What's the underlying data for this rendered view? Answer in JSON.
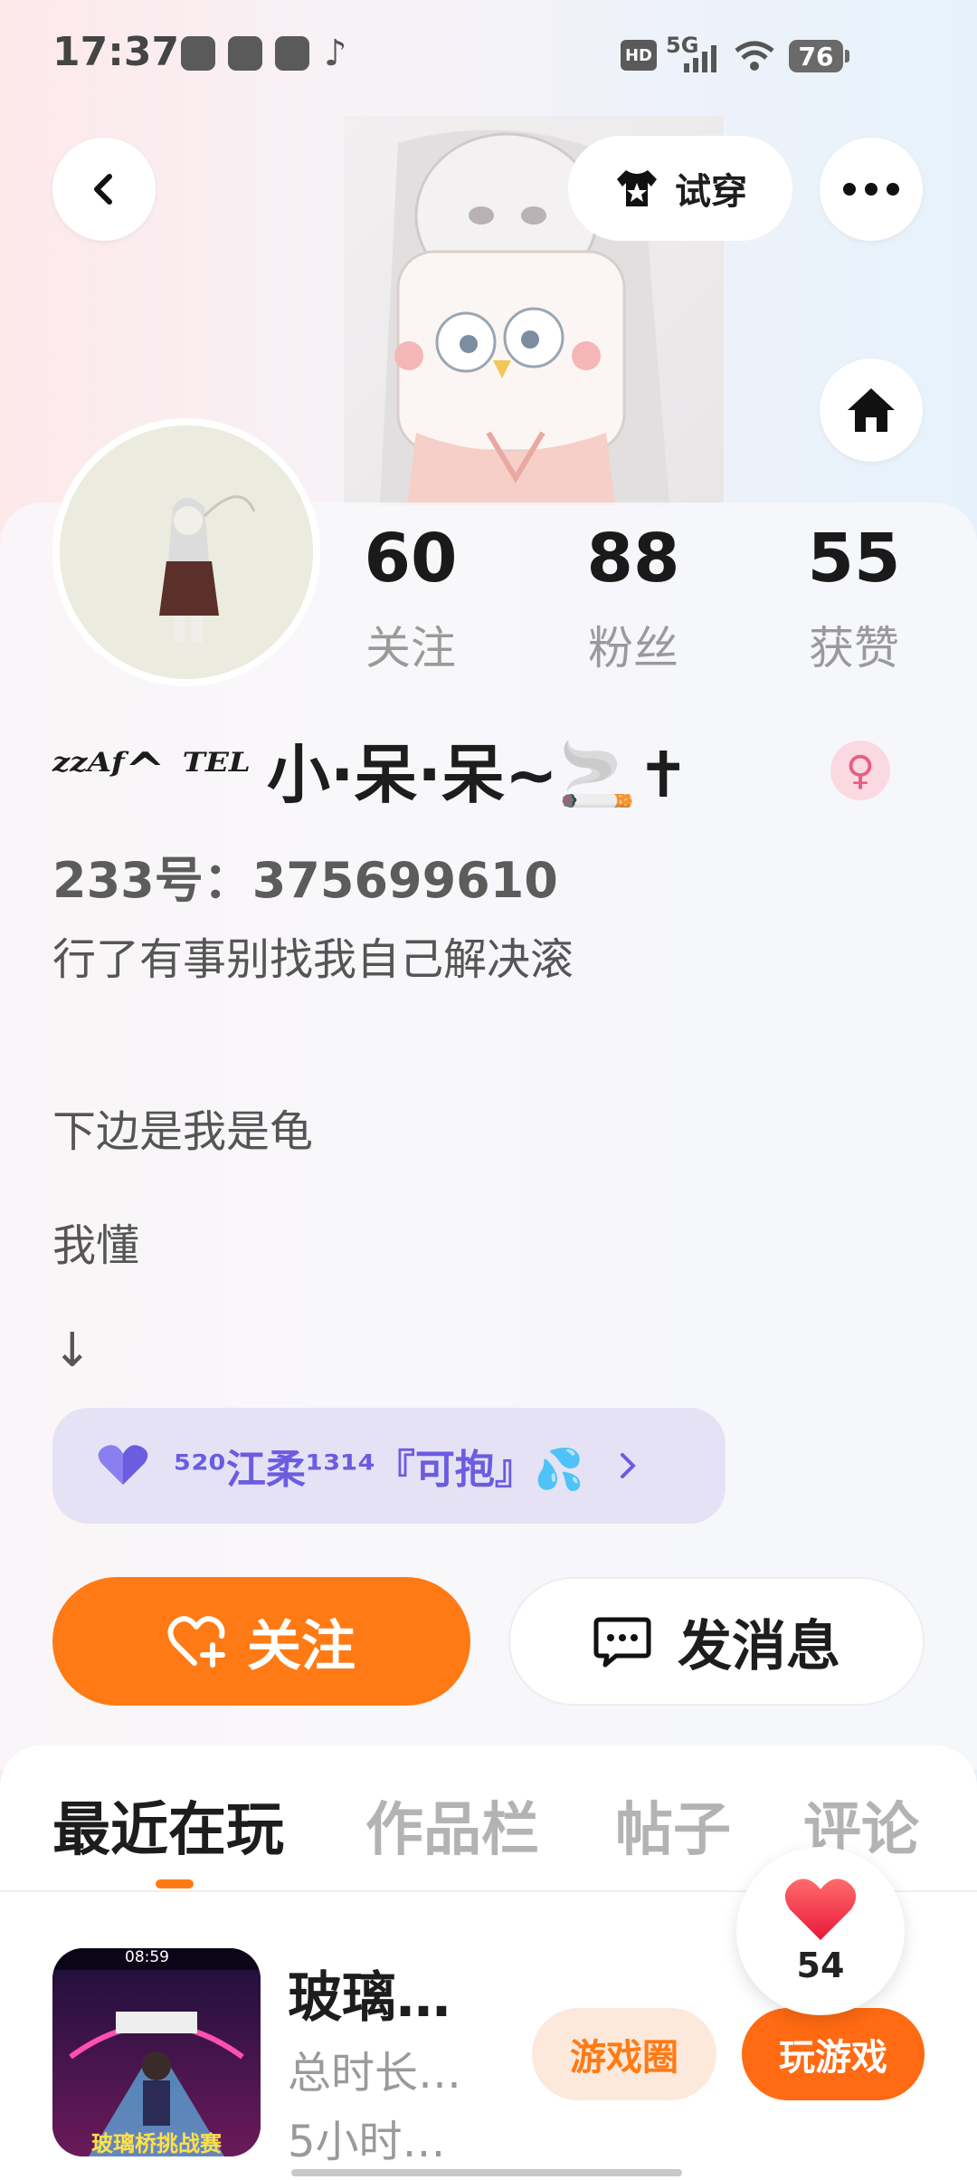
{
  "status_bar": {
    "time": "17:37",
    "network": "5G",
    "battery": "76",
    "hd": "HD"
  },
  "header": {
    "tryon_label": "试穿"
  },
  "stats": [
    {
      "value": "60",
      "label": "关注"
    },
    {
      "value": "88",
      "label": "粉丝"
    },
    {
      "value": "55",
      "label": "获赞"
    }
  ],
  "profile": {
    "nickname_prefix": "ᶻᶻᴬᶠ^ ᵀᴱᴸ",
    "nickname": "小·呆·呆~🚬✝",
    "gender_symbol": "♀",
    "id_line": "233号：375699610",
    "bio": [
      "行了有事别找我自己解决滚",
      "下边是我是龟",
      "我懂",
      "↓"
    ]
  },
  "tag": {
    "text": "⁵²⁰江柔¹³¹⁴『可抱』💦",
    "accent": "#6c5ce0"
  },
  "buttons": {
    "follow": "关注",
    "message": "发消息"
  },
  "tabs": [
    "最近在玩",
    "作品栏",
    "帖子",
    "评论"
  ],
  "game": {
    "title": "玻璃…",
    "sub1": "总时长…",
    "sub2": "5小时…",
    "circle_label": "游戏圈",
    "play_label": "玩游戏",
    "thumb_caption": "玻璃桥挑战赛",
    "thumb_timer": "08:59"
  },
  "like": {
    "count": "54"
  },
  "colors": {
    "brand": "#ff7a14",
    "purple": "#6c5ce0"
  }
}
